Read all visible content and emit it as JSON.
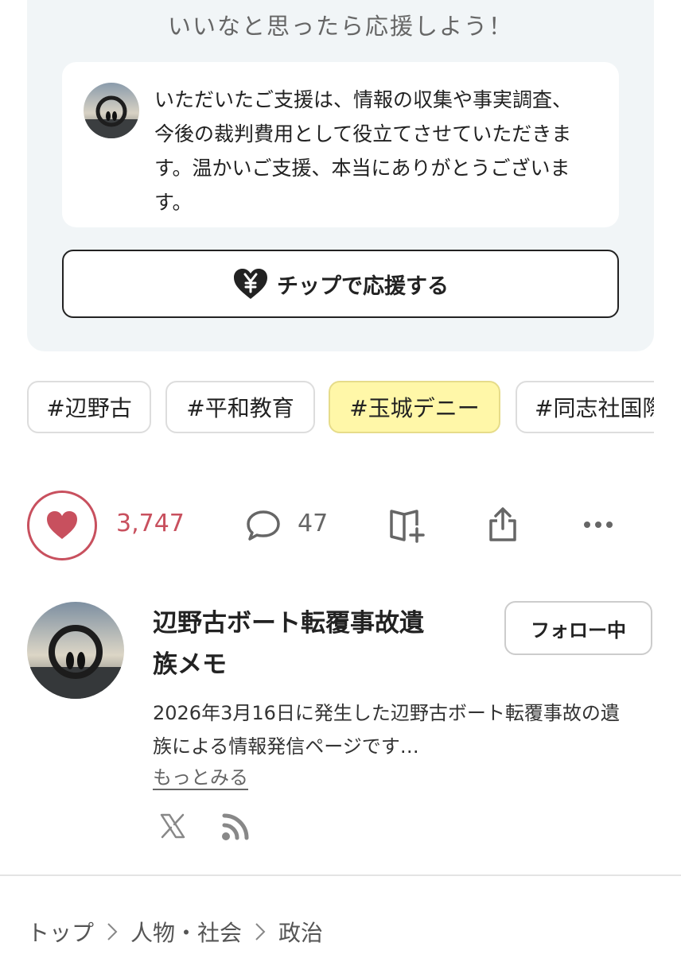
{
  "support": {
    "title": "いいなと思ったら応援しよう！",
    "message_lines": [
      "いただいたご支援は、情報の収集や事実調査、",
      "今後の裁判費用として役立てさせていただきま",
      "す。温かいご支援、本当にありがとうございま",
      "す。"
    ],
    "tip_icon": "yen-heart-icon",
    "tip_label": "チップで応援する"
  },
  "tags": [
    "#辺野古",
    "#平和教育",
    "#玉城デニー",
    "#同志社国際"
  ],
  "actions": {
    "like_count": "3,747",
    "comment_count": "47",
    "like_color": "#c8505e"
  },
  "author": {
    "name_lines": [
      "辺野古ボート転覆事故遺",
      "族メモ"
    ],
    "follow_label": "フォロー中",
    "desc_lines": [
      "2026年3月16日に発生した辺野古ボート転覆事故の遺",
      "族による情報発信ページです…"
    ],
    "more_label": "もっとみる"
  },
  "breadcrumb": [
    "トップ",
    "人物・社会",
    "政治"
  ]
}
